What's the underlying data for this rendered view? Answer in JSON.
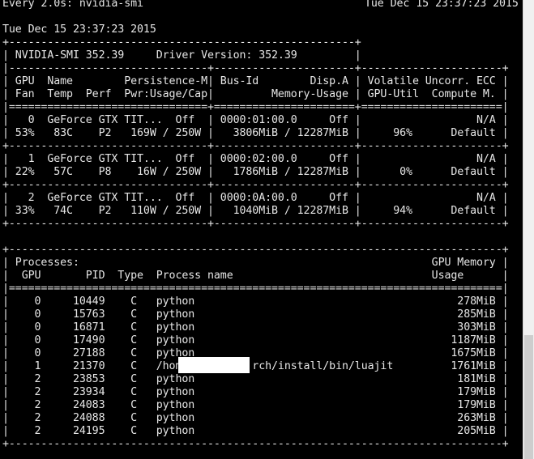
{
  "terminal": {
    "header_left": "Every 2.0s: nvidia-smi",
    "header_right": "Tue Dec 15 23:37:23 2015",
    "lines": [
      "Tue Dec 15 23:37:23 2015",
      "+------------------------------------------------------+",
      "| NVIDIA-SMI 352.39     Driver Version: 352.39         |",
      "|-------------------------------+----------------------+----------------------+",
      "| GPU  Name        Persistence-M| Bus-Id        Disp.A | Volatile Uncorr. ECC |",
      "| Fan  Temp  Perf  Pwr:Usage/Cap|         Memory-Usage | GPU-Util  Compute M. |",
      "|===============================+======================+======================|",
      "|   0  GeForce GTX TIT...  Off  | 0000:01:00.0     Off |                  N/A |",
      "| 53%   83C    P2   169W / 250W |   3806MiB / 12287MiB |     96%      Default |",
      "+-------------------------------+----------------------+----------------------+",
      "|   1  GeForce GTX TIT...  Off  | 0000:02:00.0     Off |                  N/A |",
      "| 22%   57C    P8    16W / 250W |   1786MiB / 12287MiB |      0%      Default |",
      "+-------------------------------+----------------------+----------------------+",
      "|   2  GeForce GTX TIT...  Off  | 0000:0A:00.0     Off |                  N/A |",
      "| 33%   74C    P2   110W / 250W |   1040MiB / 12287MiB |     94%      Default |",
      "+-------------------------------+----------------------+----------------------+",
      "",
      "+-----------------------------------------------------------------------------+",
      "| Processes:                                                       GPU Memory |",
      "|  GPU       PID  Type  Process name                               Usage      |",
      "|=============================================================================|",
      "|    0     10449    C   python                                         278MiB |",
      "|    0     15763    C   python                                         285MiB |",
      "|    0     16871    C   python                                         303MiB |",
      "|    0     17490    C   python                                        1187MiB |",
      "|    0     27188    C   python                                        1675MiB |",
      "|    1     21370    C   /hom           rch/install/bin/luajit         1761MiB |",
      "|    2     23853    C   python                                         181MiB |",
      "|    2     23934    C   python                                         179MiB |",
      "|    2     24083    C   python                                         179MiB |",
      "|    2     24088    C   python                                         263MiB |",
      "|    2     24195    C   python                                         205MiB |",
      "+-----------------------------------------------------------------------------+"
    ]
  },
  "colors": {
    "background": "#000000",
    "text": "#e6e6e6",
    "redaction": "#ffffff",
    "scrollbar_track": "#f0f0f0",
    "scrollbar_thumb": "#cdcdcd"
  }
}
